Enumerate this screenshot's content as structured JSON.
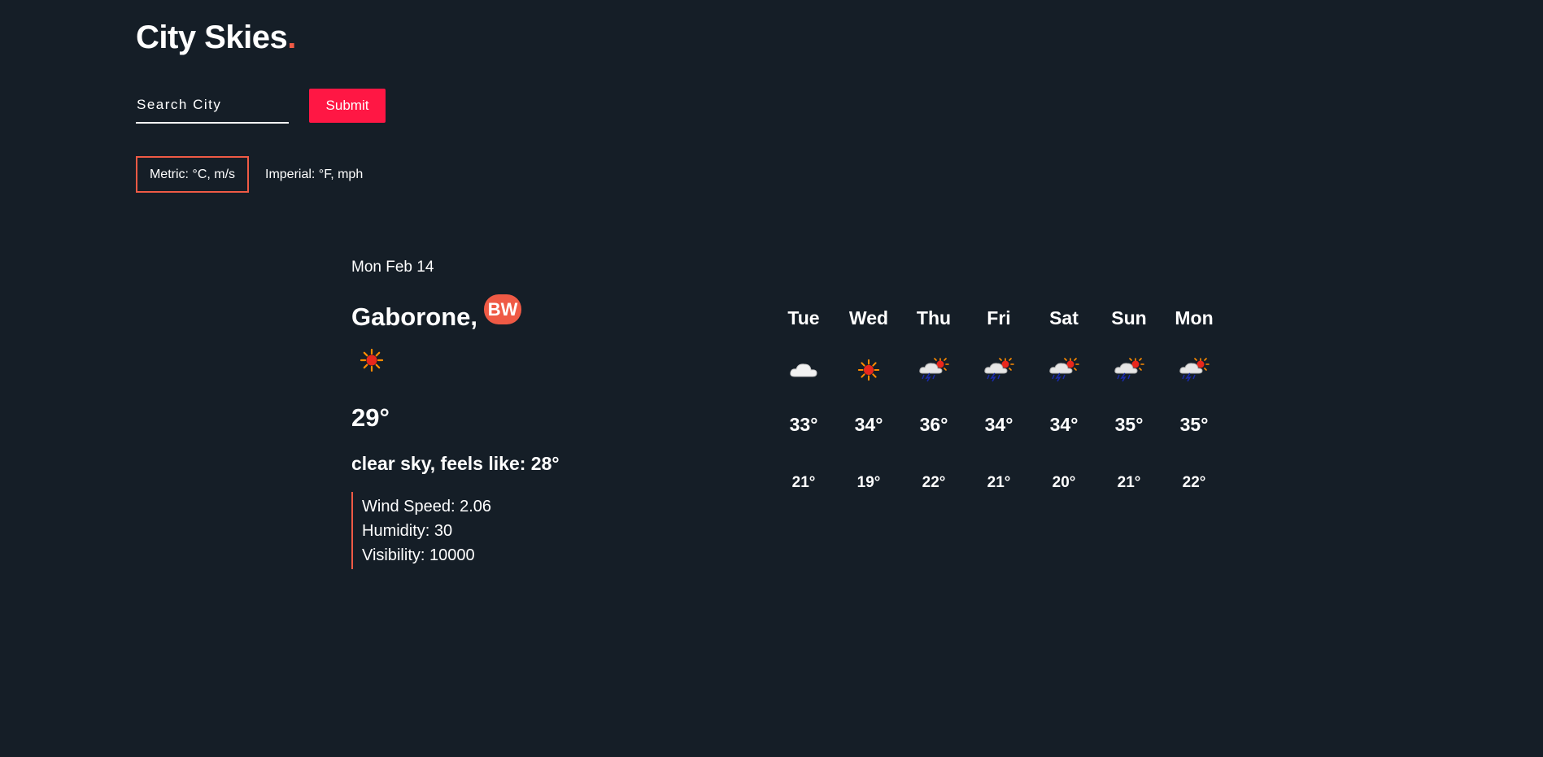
{
  "header": {
    "brand": "City Skies",
    "brand_dot": ".",
    "accent_color": "#ef5a45"
  },
  "search": {
    "placeholder": "Search City",
    "value": "",
    "submit_label": "Submit",
    "submit_color": "#ff1744"
  },
  "units": {
    "metric_label": "Metric: °C, m/s",
    "imperial_label": "Imperial: °F, mph",
    "selected": "metric"
  },
  "current": {
    "date": "Mon Feb 14",
    "city": "Gaborone,",
    "country": "BW",
    "icon": "sun-icon",
    "temp": "29°",
    "description": "clear sky, feels like: 28°",
    "wind": "Wind Speed: 2.06",
    "humidity": "Humidity: 30",
    "visibility": "Visibility: 10000"
  },
  "forecast": [
    {
      "day": "Tue",
      "icon": "cloud-icon",
      "high": "33°",
      "low": "21°"
    },
    {
      "day": "Wed",
      "icon": "sun-icon",
      "high": "34°",
      "low": "19°"
    },
    {
      "day": "Thu",
      "icon": "thunderstorm-sun-icon",
      "high": "36°",
      "low": "22°"
    },
    {
      "day": "Fri",
      "icon": "thunderstorm-sun-icon",
      "high": "34°",
      "low": "21°"
    },
    {
      "day": "Sat",
      "icon": "thunderstorm-sun-icon",
      "high": "34°",
      "low": "20°"
    },
    {
      "day": "Sun",
      "icon": "thunderstorm-sun-icon",
      "high": "35°",
      "low": "21°"
    },
    {
      "day": "Mon",
      "icon": "thunderstorm-sun-icon",
      "high": "35°",
      "low": "22°"
    }
  ]
}
